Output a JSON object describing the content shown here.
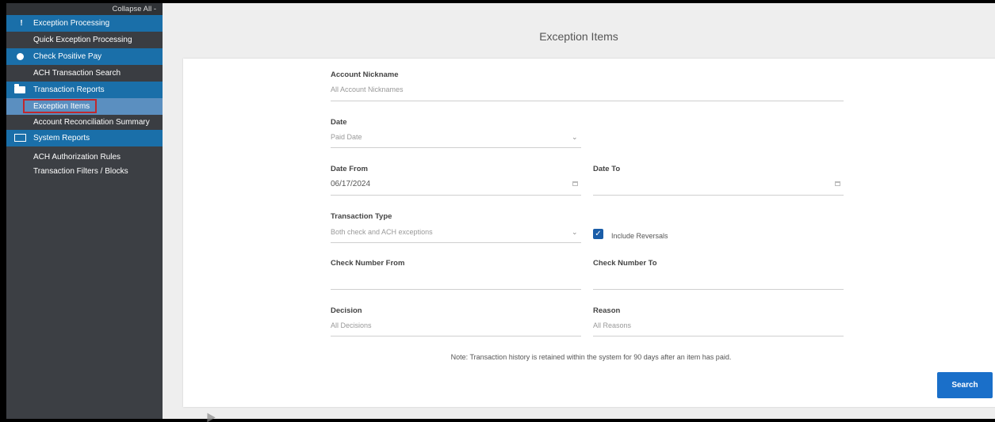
{
  "sidebar": {
    "collapse_label": "Collapse All -",
    "sections": [
      {
        "label": "Exception Processing",
        "icon": "exclamation-icon"
      },
      {
        "label": "Check Positive Pay",
        "icon": "circle-icon"
      },
      {
        "label": "Transaction Reports",
        "icon": "folder-icon"
      },
      {
        "label": "System Reports",
        "icon": "system-icon"
      }
    ],
    "items": {
      "quick_exception": "Quick Exception Processing",
      "ach_search": "ACH Transaction Search",
      "exception_items": "Exception Items",
      "account_recon": "Account Reconciliation Summary",
      "ach_auth": "ACH Authorization Rules",
      "txn_filters": "Transaction Filters / Blocks"
    }
  },
  "main": {
    "title": "Exception Items",
    "account_nickname": {
      "label": "Account Nickname",
      "value": "All Account Nicknames"
    },
    "date": {
      "label": "Date",
      "value": "Paid Date"
    },
    "date_from": {
      "label": "Date From",
      "value": "06/17/2024"
    },
    "date_to": {
      "label": "Date To",
      "value": ""
    },
    "transaction_type": {
      "label": "Transaction Type",
      "value": "Both check and ACH exceptions"
    },
    "include_reversals": {
      "label": "Include Reversals",
      "checked": true
    },
    "check_from": {
      "label": "Check Number From",
      "value": ""
    },
    "check_to": {
      "label": "Check Number To",
      "value": ""
    },
    "decision": {
      "label": "Decision",
      "value": "All Decisions"
    },
    "reason": {
      "label": "Reason",
      "value": "All Reasons"
    },
    "note": "Note: Transaction history is retained within the system for 90 days after an item has paid.",
    "search_label": "Search"
  },
  "colors": {
    "accent": "#1a6fa9",
    "active": "#5b8fc0",
    "button": "#1a6fc9",
    "highlight_border": "#c0282d"
  }
}
